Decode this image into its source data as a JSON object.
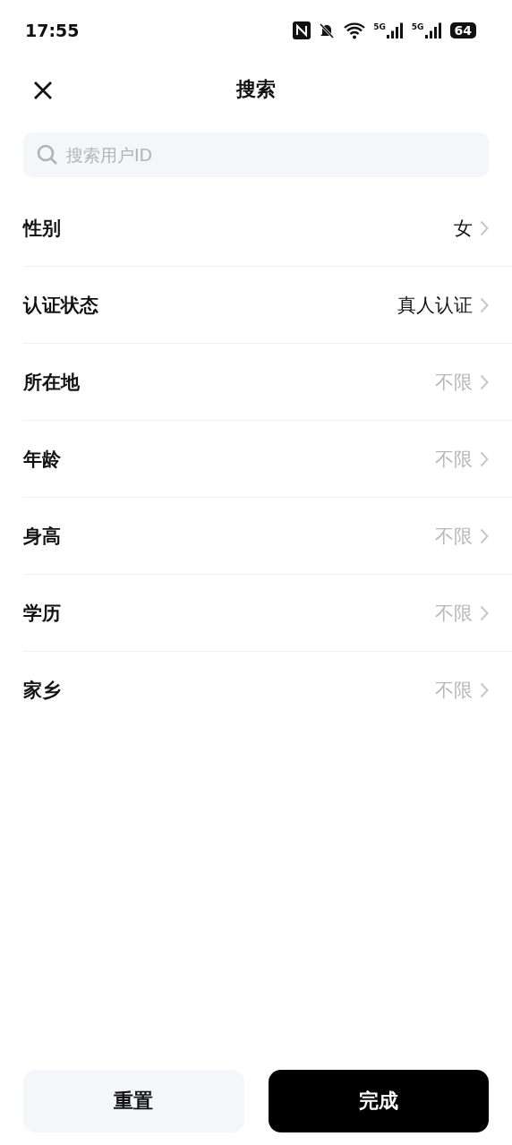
{
  "status_bar": {
    "time": "17:55",
    "battery": "64",
    "network_1": "5G",
    "network_2": "5G"
  },
  "header": {
    "title": "搜索"
  },
  "search": {
    "placeholder": "搜索用户ID"
  },
  "filters": [
    {
      "label": "性别",
      "value": "女",
      "set": true
    },
    {
      "label": "认证状态",
      "value": "真人认证",
      "set": true
    },
    {
      "label": "所在地",
      "value": "不限",
      "set": false
    },
    {
      "label": "年龄",
      "value": "不限",
      "set": false
    },
    {
      "label": "身高",
      "value": "不限",
      "set": false
    },
    {
      "label": "学历",
      "value": "不限",
      "set": false
    },
    {
      "label": "家乡",
      "value": "不限",
      "set": false
    }
  ],
  "buttons": {
    "reset": "重置",
    "done": "完成"
  }
}
